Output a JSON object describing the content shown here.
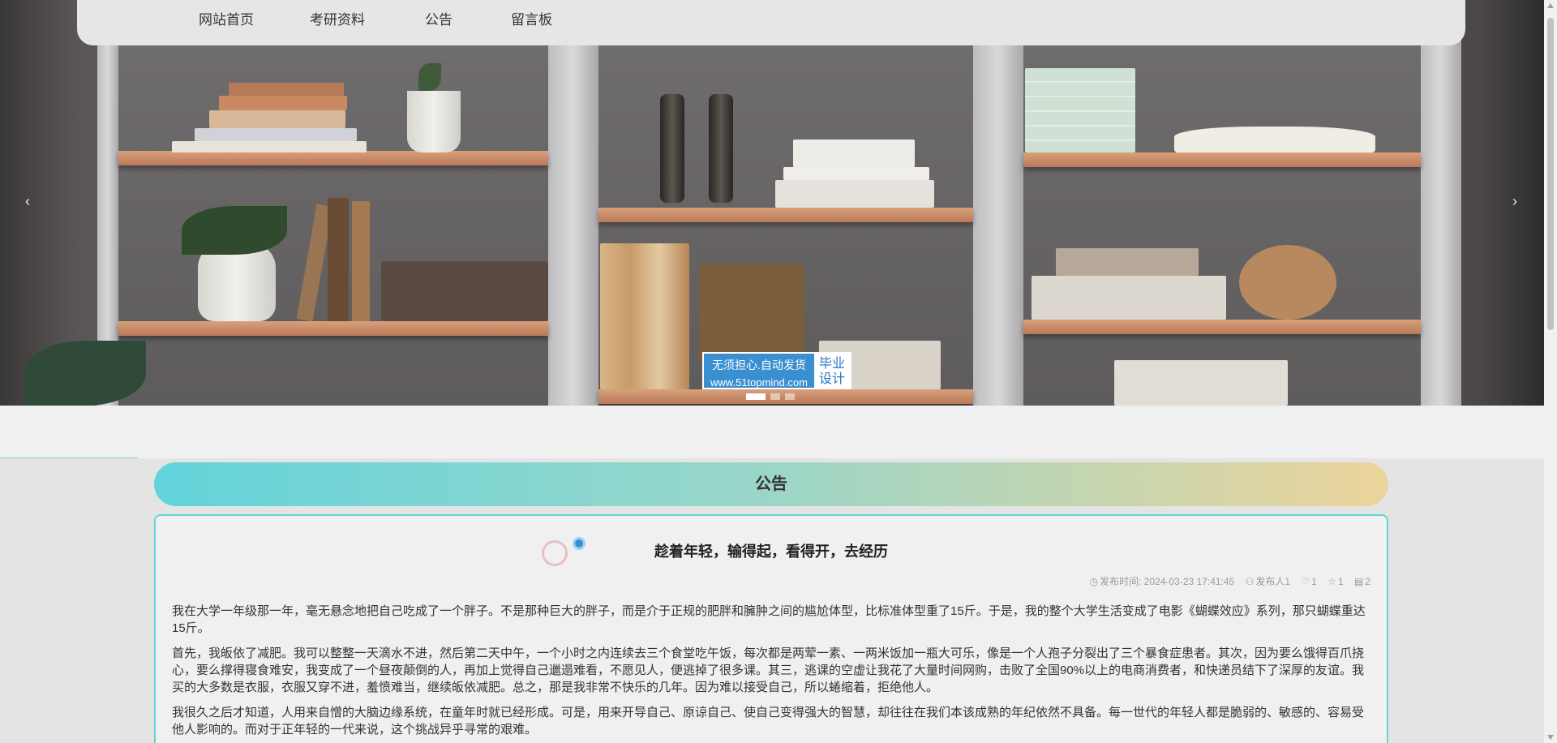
{
  "nav": {
    "items": [
      {
        "label": "网站首页"
      },
      {
        "label": "考研资料"
      },
      {
        "label": "公告"
      },
      {
        "label": "留言板"
      }
    ]
  },
  "carousel": {
    "prev_icon": "chevron-left-icon",
    "next_icon": "chevron-right-icon",
    "prev_glyph": "‹",
    "next_glyph": "›",
    "slide_count": 3,
    "active_index": 0,
    "ad": {
      "line1": "无须担心.自动发货",
      "line2": "www.51topmind.com",
      "right": "毕业设计"
    }
  },
  "section": {
    "title": "公告"
  },
  "article": {
    "title": "趁着年轻，输得起，看得开，去经历",
    "meta": {
      "time_label": "发布时间: 2024-03-23 17:41:45",
      "author": "发布人1",
      "likes": "1",
      "favorites": "1",
      "comments": "2"
    },
    "paragraphs": [
      "我在大学一年级那一年，毫无悬念地把自己吃成了一个胖子。不是那种巨大的胖子，而是介于正规的肥胖和臃肿之间的尴尬体型，比标准体型重了15斤。于是，我的整个大学生活变成了电影《蝴蝶效应》系列，那只蝴蝶重达15斤。",
      "首先，我皈依了减肥。我可以整整一天滴水不进，然后第二天中午，一个小时之内连续去三个食堂吃午饭，每次都是两荤一素、一两米饭加一瓶大可乐，像是一个人孢子分裂出了三个暴食症患者。其次，因为要么饿得百爪挠心，要么撑得寝食难安，我变成了一个昼夜颠倒的人，再加上觉得自己邋遢难看，不愿见人，便逃掉了很多课。其三，逃课的空虚让我花了大量时间网购，击败了全国90%以上的电商消费者，和快递员结下了深厚的友谊。我买的大多数是衣服，衣服又穿不进，羞愤难当，继续皈依减肥。总之，那是我非常不快乐的几年。因为难以接受自己，所以蜷缩着，拒绝他人。",
      "我很久之后才知道，人用来自憎的大脑边缘系统，在童年时就已经形成。可是，用来开导自己、原谅自己、使自己变得强大的智慧，却往往在我们本该成熟的年纪依然不具备。每一世代的年轻人都是脆弱的、敏感的、容易受他人影响的。而对于正年轻的一代来说，这个挑战异乎寻常的艰难。"
    ]
  },
  "colors": {
    "accent": "#63d4dc",
    "gradient_end": "#ecd49a",
    "ad_blue": "#3a8fd1"
  }
}
